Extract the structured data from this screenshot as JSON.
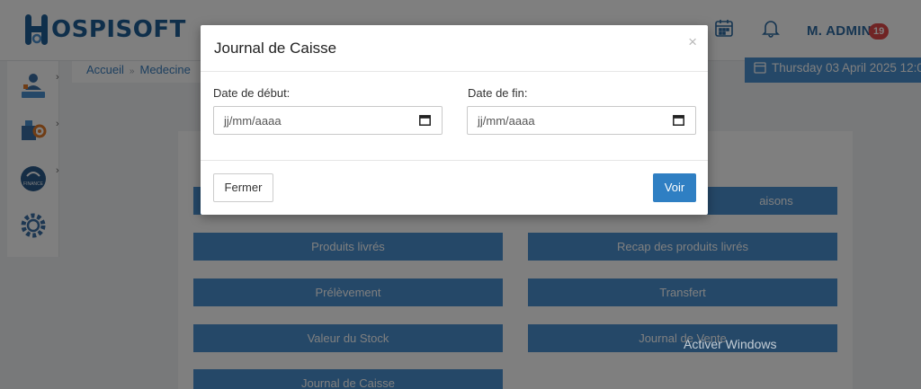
{
  "header": {
    "logo_rest": "OSPISOFT",
    "admin_name": "M. ADMIN",
    "notification_count": "19"
  },
  "sidebar": {
    "icons": [
      "patient-icon",
      "stock-icon",
      "finance-icon",
      "settings-icon"
    ],
    "finance_label": "FINANCE"
  },
  "breadcrumb": {
    "items": [
      "Accueil",
      "Medecine"
    ]
  },
  "datebox": {
    "text": "Thursday 03 April 2025 12:0"
  },
  "reports": {
    "row1_right_partial": "aisons",
    "produits_livres": "Produits livrés",
    "recap_produits_livres": "Recap des produits livrés",
    "prelevement": "Prélèvement",
    "transfert": "Transfert",
    "valeur_stock": "Valeur du Stock",
    "journal_vente": "Journal de Vente",
    "journal_caisse": "Journal de Caisse"
  },
  "modal": {
    "title": "Journal de Caisse",
    "close_glyph": "×",
    "start_label": "Date de début:",
    "end_label": "Date de fin:",
    "start_value": "jj/mm/aaaa",
    "end_value": "jj/mm/aaaa",
    "fermer_label": "Fermer",
    "voir_label": "Voir"
  },
  "watermark": {
    "text": "Activer Windows"
  },
  "colors": {
    "brand": "#1f5f96",
    "accent": "#4a90d0",
    "primary_button": "#2f7fc3",
    "badge": "#e04848"
  }
}
